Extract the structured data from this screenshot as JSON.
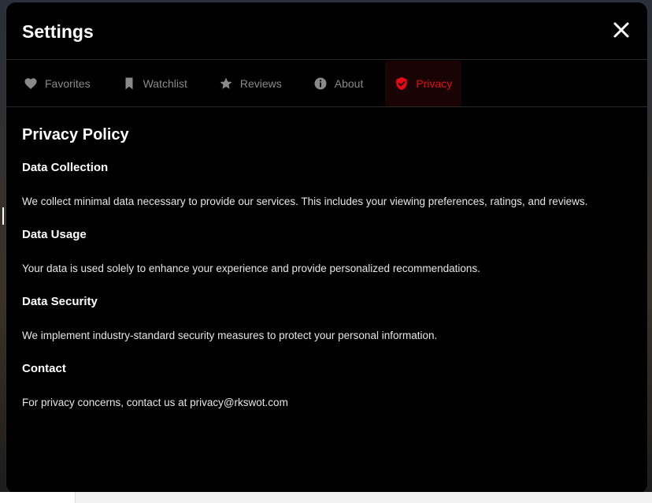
{
  "modal": {
    "title": "Settings",
    "close_icon": "close-icon"
  },
  "tabs": [
    {
      "label": "Favorites",
      "icon": "heart-icon",
      "active": false
    },
    {
      "label": "Watchlist",
      "icon": "bookmark-icon",
      "active": false
    },
    {
      "label": "Reviews",
      "icon": "star-icon",
      "active": false
    },
    {
      "label": "About",
      "icon": "info-icon",
      "active": false
    },
    {
      "label": "Privacy",
      "icon": "shield-icon",
      "active": true
    }
  ],
  "privacy": {
    "title": "Privacy Policy",
    "sections": [
      {
        "heading": "Data Collection",
        "text": "We collect minimal data necessary to provide our services. This includes your viewing preferences, ratings, and reviews."
      },
      {
        "heading": "Data Usage",
        "text": "Your data is used solely to enhance your experience and provide personalized recommendations."
      },
      {
        "heading": "Data Security",
        "text": "We implement industry-standard security measures to protect your personal information."
      },
      {
        "heading": "Contact",
        "text": "For privacy concerns, contact us at privacy@rkswot.com"
      }
    ]
  },
  "colors": {
    "accent": "#e50914",
    "tab_inactive": "#8a8a8a",
    "background": "#000000"
  }
}
